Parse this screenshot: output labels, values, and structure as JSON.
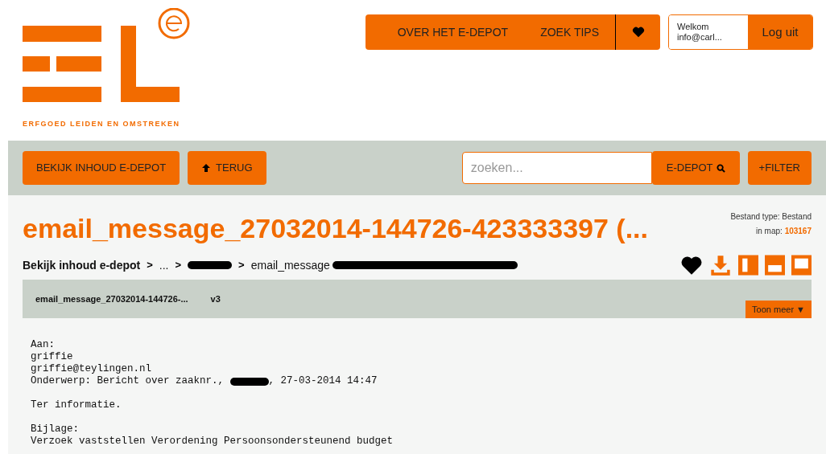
{
  "logo": {
    "caption": "ERFGOED LEIDEN EN OMSTREKEN"
  },
  "top_nav": {
    "links": [
      "OVER HET E-DEPOT",
      "ZOEK TIPS"
    ],
    "welcome": [
      "Welkom",
      "info@carl..."
    ],
    "logout": "Log uit"
  },
  "toolbar": {
    "buttons": [
      "BEKIJK INHOUD E-DEPOT",
      "TERUG"
    ],
    "search": {
      "placeholder": "zoeken..."
    },
    "search_button": "E-DEPOT",
    "filter_button": "+FILTER"
  },
  "file": {
    "title": "email_message_27032014-144726-423333397 (...",
    "type_label": "Bestand type: Bestand",
    "map_label": "in map:",
    "map_value": "103167"
  },
  "breadcrumb_separator": ">",
  "breadcrumb": [
    {
      "kind": "link",
      "text": "Bekijk inhoud e-depot"
    },
    {
      "kind": "text",
      "text": "..."
    },
    {
      "kind": "redacted"
    },
    {
      "kind": "text",
      "text": "email_message"
    }
  ],
  "version_bar": {
    "name": "email_message_27032014-144726-...",
    "version": "v3",
    "more": "Toon meer ▼"
  },
  "message": [
    {
      "kind": "line",
      "text": "Aan:"
    },
    {
      "kind": "line",
      "text": "griffie"
    },
    {
      "kind": "line",
      "text": "griffie@teylingen.nl"
    },
    {
      "kind": "redacted_line",
      "before": "Onderwerp: Bericht over zaaknr., ",
      "after": ", 27-03-2014 14:47"
    },
    {
      "kind": "blank"
    },
    {
      "kind": "line",
      "text": "Ter informatie."
    },
    {
      "kind": "blank"
    },
    {
      "kind": "line",
      "text": "Bijlage:"
    },
    {
      "kind": "line",
      "text": "Verzoek vaststellen Verordening Persoonsondersteunend budget"
    }
  ]
}
